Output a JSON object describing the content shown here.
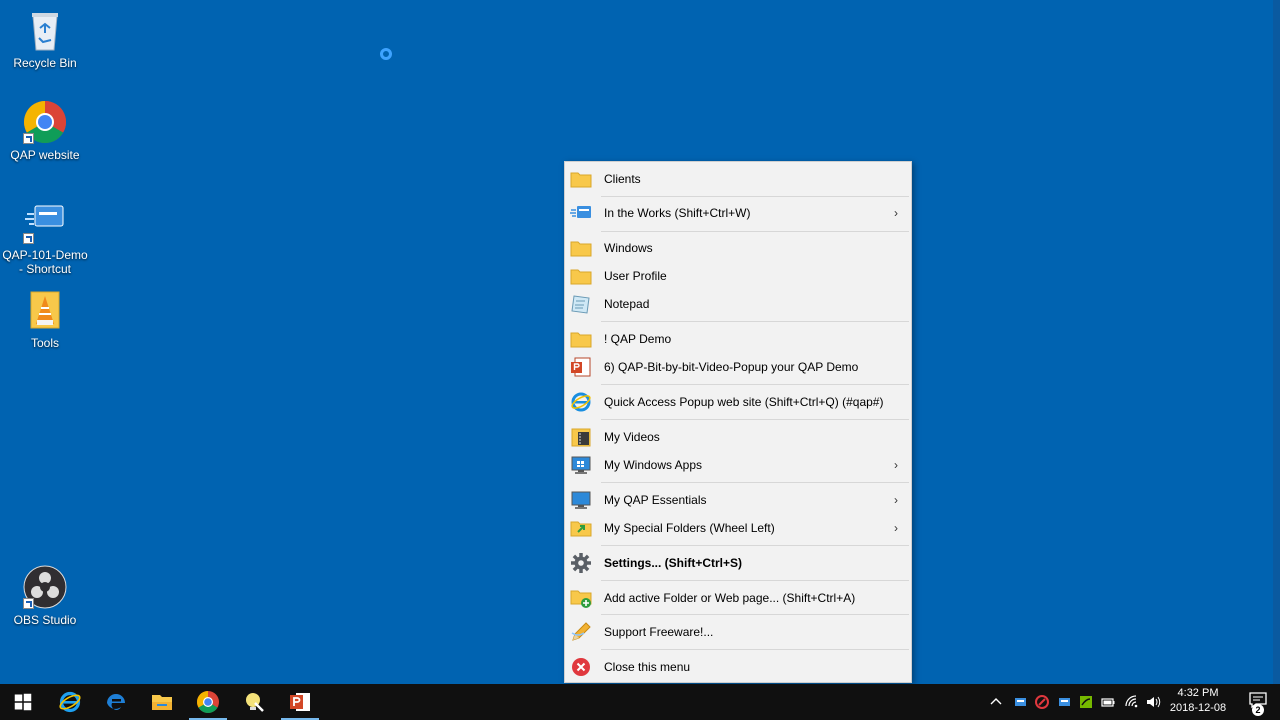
{
  "desktop": {
    "icons": [
      {
        "label": "Recycle Bin",
        "icon": "recycle-bin-icon"
      },
      {
        "label": "QAP website",
        "icon": "chrome-icon"
      },
      {
        "label": "QAP-101-Demo - Shortcut",
        "icon": "qap-app-icon"
      },
      {
        "label": "Tools",
        "icon": "folder-vlc-icon"
      },
      {
        "label": "OBS Studio",
        "icon": "obs-icon"
      }
    ]
  },
  "menu": {
    "items": [
      {
        "label": "Clients",
        "icon": "folder-icon",
        "submenu": false
      },
      {
        "label": "In the Works (Shift+Ctrl+W)",
        "icon": "qap-app-icon",
        "submenu": true
      },
      {
        "label": "Windows",
        "icon": "folder-icon",
        "submenu": false
      },
      {
        "label": "User Profile",
        "icon": "folder-icon",
        "submenu": false
      },
      {
        "label": "Notepad",
        "icon": "notepad-icon",
        "submenu": false
      },
      {
        "label": "! QAP Demo",
        "icon": "folder-icon",
        "submenu": false
      },
      {
        "label": "6) QAP-Bit-by-bit-Video-Popup your QAP Demo",
        "icon": "powerpoint-file-icon",
        "submenu": false
      },
      {
        "label": "Quick Access Popup web site (Shift+Ctrl+Q) (#qap#)",
        "icon": "ie-icon",
        "submenu": false
      },
      {
        "label": "My Videos",
        "icon": "videos-folder-icon",
        "submenu": false
      },
      {
        "label": "My Windows Apps",
        "icon": "monitor-icon",
        "submenu": true
      },
      {
        "label": "My QAP Essentials",
        "icon": "monitor-icon",
        "submenu": true
      },
      {
        "label": "My Special Folders (Wheel Left)",
        "icon": "special-folder-icon",
        "submenu": true
      },
      {
        "label": "Settings... (Shift+Ctrl+S)",
        "icon": "gear-icon",
        "submenu": false
      },
      {
        "label": "Add active Folder or Web page... (Shift+Ctrl+A)",
        "icon": "folder-add-icon",
        "submenu": false
      },
      {
        "label": "Support Freeware!...",
        "icon": "pencil-icon",
        "submenu": false
      },
      {
        "label": "Close this menu",
        "icon": "close-icon",
        "submenu": false
      }
    ],
    "submenu_glyph": "›"
  },
  "taskbar": {
    "apps": [
      "start-icon",
      "ie-icon",
      "edge-icon",
      "file-explorer-icon",
      "chrome-icon",
      "qap-icon",
      "powerpoint-icon"
    ],
    "clock_time": "4:32 PM",
    "clock_date": "2018-12-08",
    "notification_count": "2"
  },
  "colors": {
    "desktop": "#0063b1",
    "menu_bg": "#f2f2f2",
    "taskbar": "#101010",
    "folder": "#f8c84a"
  }
}
